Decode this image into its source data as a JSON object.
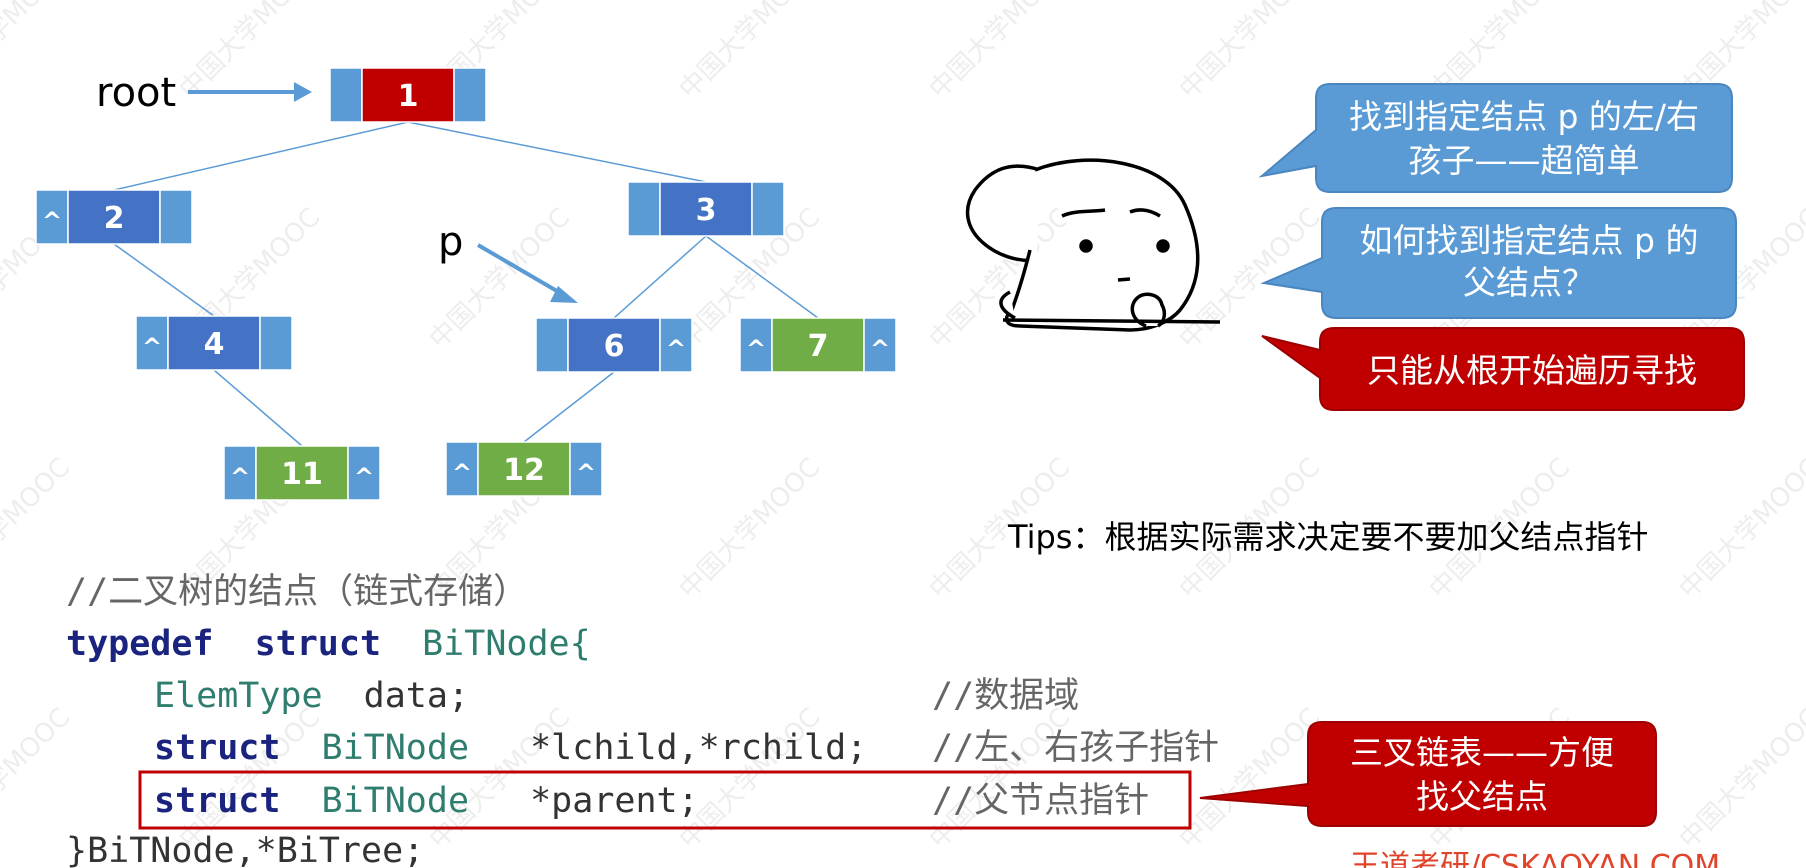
{
  "colors": {
    "node_left": "#5b9bd5",
    "node_center_blue": "#4472c4",
    "node_center_red": "#c00000",
    "node_center_green": "#70ad47",
    "bubble_blue": "#5b9bd5",
    "bubble_red": "#c00000",
    "arrow": "#5b9bd5",
    "edge": "#5b9bd5"
  },
  "tree": {
    "root_label": "root",
    "p_label": "p",
    "nodes": [
      {
        "id": "n1",
        "value": "1",
        "color": "red",
        "left": "",
        "right": ""
      },
      {
        "id": "n2",
        "value": "2",
        "color": "blue",
        "left": "^",
        "right": ""
      },
      {
        "id": "n3",
        "value": "3",
        "color": "blue",
        "left": "",
        "right": ""
      },
      {
        "id": "n4",
        "value": "4",
        "color": "blue",
        "left": "^",
        "right": ""
      },
      {
        "id": "n6",
        "value": "6",
        "color": "blue",
        "left": "",
        "right": "^"
      },
      {
        "id": "n7",
        "value": "7",
        "color": "green",
        "left": "^",
        "right": "^"
      },
      {
        "id": "n11",
        "value": "11",
        "color": "green",
        "left": "^",
        "right": "^"
      },
      {
        "id": "n12",
        "value": "12",
        "color": "green",
        "left": "^",
        "right": "^"
      }
    ],
    "edges": [
      [
        "n1",
        "n2"
      ],
      [
        "n1",
        "n3"
      ],
      [
        "n2",
        "n4"
      ],
      [
        "n3",
        "n6"
      ],
      [
        "n3",
        "n7"
      ],
      [
        "n4",
        "n11"
      ],
      [
        "n6",
        "n12"
      ]
    ]
  },
  "bubbles": {
    "b1": {
      "line1": "找到指定结点 p 的左/右",
      "line2": "孩子——超简单"
    },
    "b2": {
      "line1": "如何找到指定结点 p 的",
      "line2": "父结点？"
    },
    "b3": {
      "line1": "只能从根开始遍历寻找"
    },
    "b4": {
      "line1": "三叉链表——方便",
      "line2": "找父结点"
    }
  },
  "tips": "Tips：根据实际需求决定要不要加父结点指针",
  "code": {
    "comment_title": "//二叉树的结点（链式存储）",
    "line1_kw1": "typedef",
    "line1_kw2": "struct",
    "line1_name": "BiTNode{",
    "line2_type": "ElemType",
    "line2_rest": "data;",
    "line2_comment": "//数据域",
    "line3_kw": "struct",
    "line3_type": "BiTNode",
    "line3_rest": "*lchild,*rchild;",
    "line3_comment": "//左、右孩子指针",
    "line4_kw": "struct",
    "line4_type": "BiTNode",
    "line4_rest": "*parent;",
    "line4_comment": "//父节点指针",
    "line5": "}BiTNode,*BiTree;"
  },
  "watermark": "中国大学MOOC",
  "brand": "王道考研/CSKAOYAN.COM"
}
